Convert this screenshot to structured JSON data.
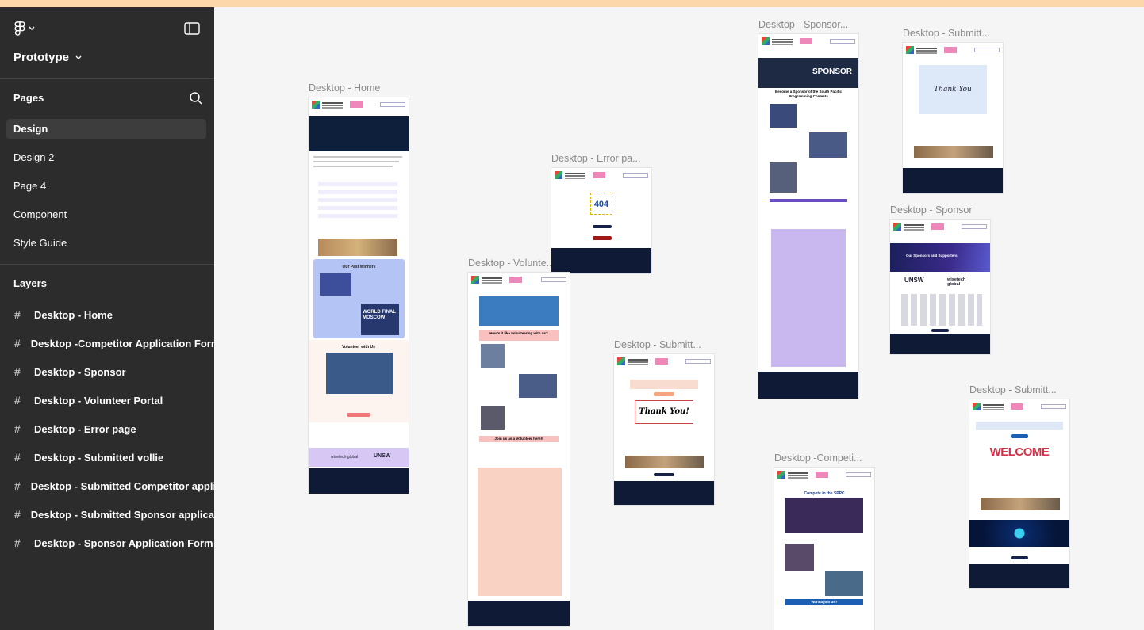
{
  "app": {
    "project_title": "Prototype",
    "logo_icon": "figma-icon"
  },
  "sidebar": {
    "pages_heading": "Pages",
    "pages": [
      {
        "label": "Design",
        "active": true
      },
      {
        "label": "Design 2",
        "active": false
      },
      {
        "label": "Page 4",
        "active": false
      },
      {
        "label": "Component",
        "active": false
      },
      {
        "label": "Style Guide",
        "active": false
      }
    ],
    "layers_heading": "Layers",
    "layers": [
      "Desktop - Home",
      "Desktop -Competitor Application Form",
      "Desktop - Sponsor",
      "Desktop - Volunteer Portal",
      "Desktop - Error page",
      "Desktop - Submitted vollie",
      "Desktop - Submitted Competitor application",
      "Desktop - Submitted Sponsor application",
      "Desktop - Sponsor Application Form"
    ],
    "layer_icon": "#"
  },
  "canvas": {
    "frame_labels": {
      "home": "Desktop - Home",
      "error": "Desktop - Error pa...",
      "volunteer": "Desktop - Volunte...",
      "submitted_a": "Desktop - Submitt...",
      "sponsor_form": "Desktop - Sponsor...",
      "submitted_b": "Desktop - Submitt...",
      "sponsor": "Desktop - Sponsor",
      "competitor": "Desktop -Competi...",
      "submitted_c": "Desktop - Submitt..."
    },
    "frame_text": {
      "error_code": "404",
      "sponsor_banner": "SPONSOR",
      "thank_you": "Thank You!",
      "thank_you_b": "Thank You",
      "welcome": "WELCOME",
      "past_winners": "Our Past Winners",
      "world_final": "WORLD FINAL MOSCOW",
      "volunteer_heading": "Volunteer with Us",
      "unsw": "UNSW",
      "wisetech": "wisetech global",
      "become_sponsor": "Become a Sponsor of the South Pacific Programming Contests",
      "compete": "Compete in the SPPC",
      "how_is_it": "How's it like volunteering with us?",
      "join_us": "Join us as a Volunteer here!!",
      "sponsors_supporters": "Our Sponsors and Supporters",
      "wanna_join": "Wanna join us?"
    }
  },
  "colors": {
    "sidebar_bg": "#2c2c2c",
    "canvas_bg": "#f5f5f5",
    "top_strip": "#fbd7a9",
    "frame_footer": "#0e1a36",
    "accent_purple": "#c9b8f0",
    "accent_peach": "#f9d2c3",
    "accent_blue": "#b4c4f4"
  }
}
